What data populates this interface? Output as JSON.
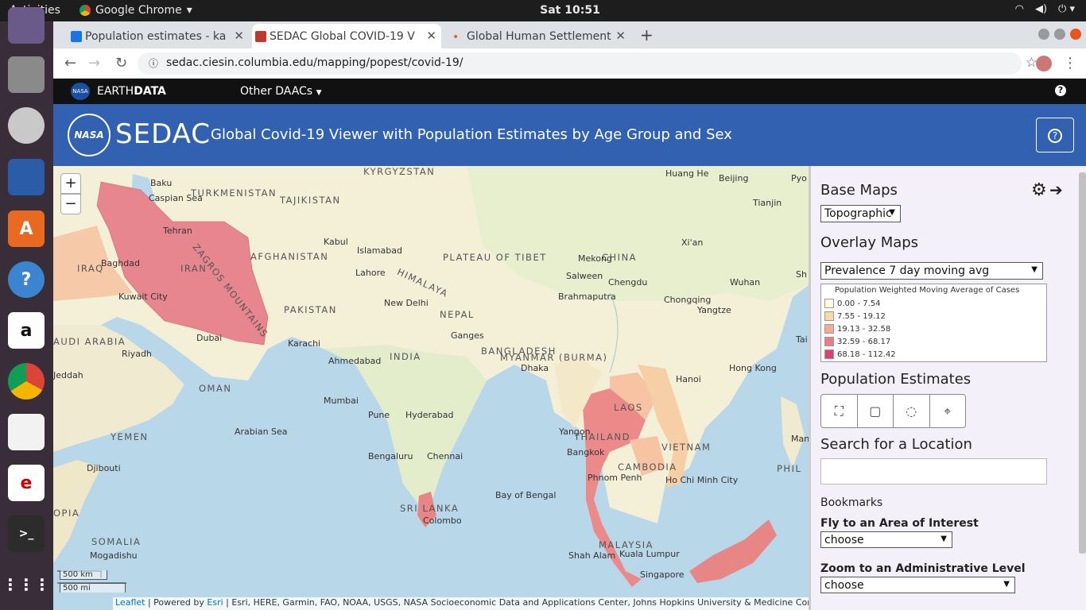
{
  "desktop": {
    "activities": "Activities",
    "app_name": "Google Chrome",
    "clock": "Sat 10:51"
  },
  "tabs": [
    {
      "title": "Population estimates - ka",
      "fav_color": "#1a73e8"
    },
    {
      "title": "SEDAC Global COVID-19 V",
      "fav_color": "#c0392b"
    },
    {
      "title": "Global Human Settlement",
      "fav_color": "#e06030"
    }
  ],
  "address": {
    "url": "sedac.ciesin.columbia.edu/mapping/popest/covid-19/"
  },
  "earthdata": {
    "logo": "NASA",
    "brand_a": "EARTH",
    "brand_b": "DATA",
    "menu": "Other DAACs",
    "help": "?"
  },
  "header": {
    "logo_badge": "NASA",
    "logo_text": "SEDAC",
    "title": "Global Covid-19 Viewer with Population Estimates by Age Group and Sex",
    "help": "?"
  },
  "map": {
    "zoom_in": "+",
    "zoom_out": "−",
    "scale_km": "500 km",
    "scale_mi": "500 mi",
    "labels": [
      {
        "t": "KYRGYZSTAN",
        "c": 1
      },
      {
        "t": "Baku",
        "c": 0
      },
      {
        "t": "TURKMENISTAN",
        "c": 1
      },
      {
        "t": "Caspian Sea",
        "c": 0
      },
      {
        "t": "TAJIKISTAN",
        "c": 1
      },
      {
        "t": "Tehran",
        "c": 0
      },
      {
        "t": "Kabul",
        "c": 0
      },
      {
        "t": "AFGHANISTAN",
        "c": 1
      },
      {
        "t": "Islamabad",
        "c": 0
      },
      {
        "t": "IRAN",
        "c": 1
      },
      {
        "t": "ZAGROS MOUNTAINS",
        "c": 1
      },
      {
        "t": "IRAQ",
        "c": 1
      },
      {
        "t": "Baghdad",
        "c": 0
      },
      {
        "t": "Lahore",
        "c": 0
      },
      {
        "t": "Kuwait City",
        "c": 0
      },
      {
        "t": "PAKISTAN",
        "c": 1
      },
      {
        "t": "New Delhi",
        "c": 0
      },
      {
        "t": "PLATEAU OF TIBET",
        "c": 1
      },
      {
        "t": "CHINA",
        "c": 1
      },
      {
        "t": "Beijing",
        "c": 0
      },
      {
        "t": "Tianjin",
        "c": 0
      },
      {
        "t": "Xi'an",
        "c": 0
      },
      {
        "t": "Chengdu",
        "c": 0
      },
      {
        "t": "Chongqing",
        "c": 0
      },
      {
        "t": "Wuhan",
        "c": 0
      },
      {
        "t": "NEPAL",
        "c": 1
      },
      {
        "t": "Dubai",
        "c": 0
      },
      {
        "t": "Riyadh",
        "c": 0
      },
      {
        "t": "AUDI ARABIA",
        "c": 1
      },
      {
        "t": "Karachi",
        "c": 0
      },
      {
        "t": "Ahmedabad",
        "c": 0
      },
      {
        "t": "INDIA",
        "c": 1
      },
      {
        "t": "BANGLADESH",
        "c": 1
      },
      {
        "t": "Dhaka",
        "c": 0
      },
      {
        "t": "MYANMAR (BURMA)",
        "c": 1
      },
      {
        "t": "Hanoi",
        "c": 0
      },
      {
        "t": "Hong Kong",
        "c": 0
      },
      {
        "t": "Jeddah",
        "c": 0
      },
      {
        "t": "OMAN",
        "c": 1
      },
      {
        "t": "Mumbai",
        "c": 0
      },
      {
        "t": "Pune",
        "c": 0
      },
      {
        "t": "Hyderabad",
        "c": 0
      },
      {
        "t": "LAOS",
        "c": 1
      },
      {
        "t": "YEMEN",
        "c": 1
      },
      {
        "t": "Arabian Sea",
        "c": 0
      },
      {
        "t": "Yangon",
        "c": 0
      },
      {
        "t": "THAILAND",
        "c": 1
      },
      {
        "t": "VIETNAM",
        "c": 1
      },
      {
        "t": "Bangkok",
        "c": 0
      },
      {
        "t": "Djibouti",
        "c": 0
      },
      {
        "t": "Bengaluru",
        "c": 0
      },
      {
        "t": "Chennai",
        "c": 0
      },
      {
        "t": "CAMBODIA",
        "c": 1
      },
      {
        "t": "Phnom Penh",
        "c": 0
      },
      {
        "t": "Ho Chi Minh City",
        "c": 0
      },
      {
        "t": "SRI LANKA",
        "c": 1
      },
      {
        "t": "Bay of Bengal",
        "c": 0
      },
      {
        "t": "Colombo",
        "c": 0
      },
      {
        "t": "SOMALIA",
        "c": 1
      },
      {
        "t": "MALAYSIA",
        "c": 1
      },
      {
        "t": "Mogadishu",
        "c": 0
      },
      {
        "t": "Shah Alam",
        "c": 0
      },
      {
        "t": "Kuala Lumpur",
        "c": 0
      },
      {
        "t": "Singapore",
        "c": 0
      },
      {
        "t": "HIMALAYA",
        "c": 1
      },
      {
        "t": "Mekong",
        "c": 0
      },
      {
        "t": "Salween",
        "c": 0
      },
      {
        "t": "Brahmaputra",
        "c": 0
      },
      {
        "t": "Ganges",
        "c": 0
      },
      {
        "t": "Huang He",
        "c": 0
      },
      {
        "t": "Yangtze",
        "c": 0
      },
      {
        "t": "Pyo",
        "c": 0
      },
      {
        "t": "Sh",
        "c": 0
      },
      {
        "t": "Tai",
        "c": 0
      },
      {
        "t": "Man",
        "c": 0
      },
      {
        "t": "PHIL",
        "c": 1
      },
      {
        "t": "OPIA",
        "c": 1
      }
    ],
    "attribution": {
      "leaflet": "Leaflet",
      "powered": " | Powered by ",
      "esri": "Esri",
      "rest": " | Esri, HERE, Garmin, FAO, NOAA, USGS, NASA Socioeconomic Data and Applications Center, Johns Hopkins University & Medicine Coronavirus Resou"
    }
  },
  "panel": {
    "base_maps": "Base Maps",
    "base_value": "Topographic",
    "overlay_maps": "Overlay Maps",
    "overlay_value": "Prevalence 7 day moving avg",
    "legend_title": "Population Weighted Moving Average of Cases",
    "legend": [
      {
        "range": "0.00 - 7.54",
        "color": "#fffbe0"
      },
      {
        "range": "7.55 - 19.12",
        "color": "#fbd7a8"
      },
      {
        "range": "19.13 - 32.58",
        "color": "#f6aa92"
      },
      {
        "range": "32.59 - 68.17",
        "color": "#ee7a86"
      },
      {
        "range": "68.18 - 112.42",
        "color": "#e23d6c"
      }
    ],
    "pop_estimates": "Population Estimates",
    "search_title": "Search for a Location",
    "search_value": "",
    "bookmarks": "Bookmarks",
    "fly_label": "Fly to an Area of Interest",
    "fly_value": "choose",
    "zoom_label": "Zoom to an Administrative Level",
    "zoom_value": "choose"
  }
}
